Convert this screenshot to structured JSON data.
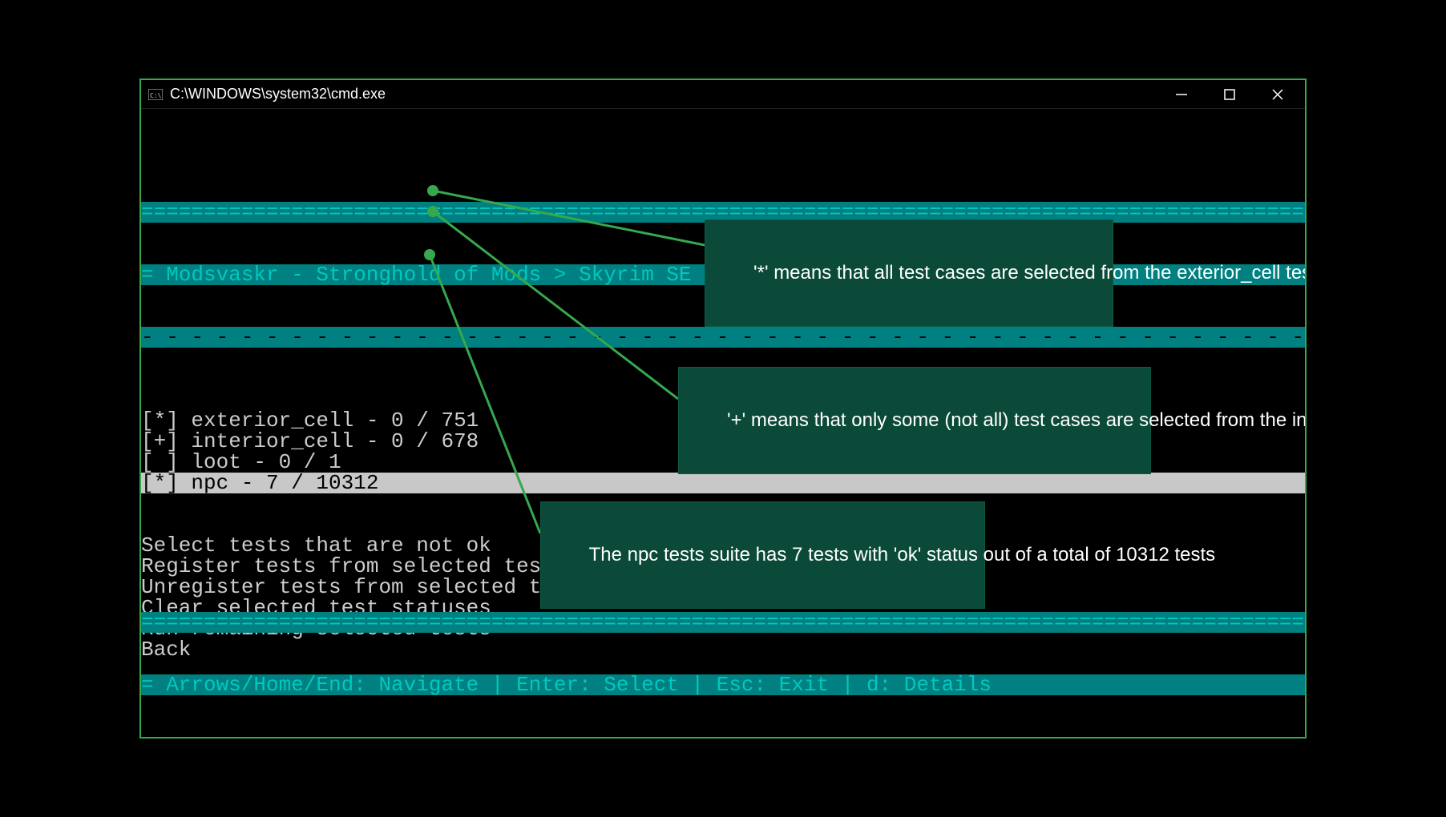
{
  "window": {
    "title": "C:\\WINDOWS\\system32\\cmd.exe"
  },
  "header": {
    "breadcrumb": "= Modsvaskr - Stronghold of Mods > Skyrim SE > Testing"
  },
  "suites": [
    {
      "marker": "*",
      "name": "exterior_cell",
      "ok": 0,
      "total": 751,
      "selected": false
    },
    {
      "marker": "+",
      "name": "interior_cell",
      "ok": 0,
      "total": 678,
      "selected": false
    },
    {
      "marker": " ",
      "name": "loot",
      "ok": 0,
      "total": 1,
      "selected": false
    },
    {
      "marker": "*",
      "name": "npc",
      "ok": 7,
      "total": 10312,
      "selected": true
    }
  ],
  "menu": [
    "Select tests that are not ok",
    "Register tests from selected test suites",
    "Unregister tests from selected test suites",
    "Clear selected test statuses",
    "Run remaining selected tests",
    "Back"
  ],
  "footer": {
    "help": "= Arrows/Home/End: Navigate | Enter: Select | Esc: Exit | d: Details"
  },
  "annotations": {
    "a1": "'*' means that all test cases are selected from the exterior_cell tests suite",
    "a2": "'+' means that only some (not all) test cases are selected from the interior_cell tests suite",
    "a3": "The npc tests suite has 7 tests with 'ok' status out of a total of 10312 tests"
  },
  "ruler_equals": "=============================================================================================================================================================================",
  "ruler_dashes": "- - - - - - - - - - - - - - - - - - - - - - - - - - - - - - - - - - - - - - - - - - - - - - - - - - - - - - - - - - - - - - - - - - - - - - - - - - - - - - - - - - - - - - - - "
}
